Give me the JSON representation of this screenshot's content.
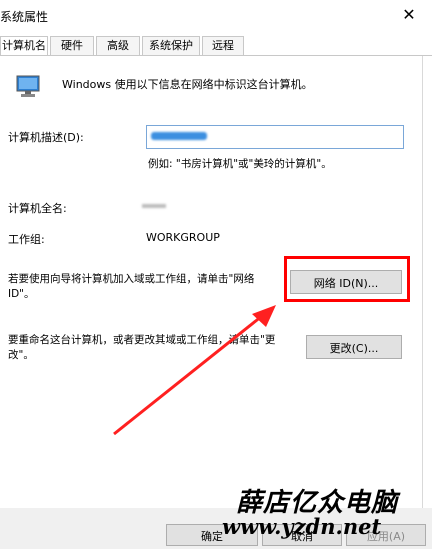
{
  "window": {
    "title": "系统属性",
    "close_glyph": "✕"
  },
  "tabs": [
    {
      "label": "计算机名",
      "active": true
    },
    {
      "label": "硬件",
      "active": false
    },
    {
      "label": "高级",
      "active": false
    },
    {
      "label": "系统保护",
      "active": false
    },
    {
      "label": "远程",
      "active": false
    }
  ],
  "main": {
    "info_text": "Windows 使用以下信息在网络中标识这台计算机。",
    "description_label": "计算机描述(D):",
    "description_example": "例如: \"书房计算机\"或\"美玲的计算机\"。",
    "fullname_label": "计算机全名:",
    "workgroup_label": "工作组:",
    "workgroup_value": "WORKGROUP",
    "network_text": "若要使用向导将计算机加入域或工作组，请单击\"网络 ID\"。",
    "network_button": "网络 ID(N)...",
    "rename_text": "要重命名这台计算机，或者更改其域或工作组，请单击\"更改\"。",
    "change_button": "更改(C)..."
  },
  "footer": {
    "ok_button": "确定",
    "cancel_button": "取消",
    "apply_button": "应用(A)"
  },
  "watermark": {
    "name": "薛店亿众电脑",
    "url": "www.yzdn.net"
  },
  "colors": {
    "highlight": "#ff0000",
    "arrow": "#ff2020"
  },
  "icons": [
    "computer-icon",
    "close-icon",
    "arrow-annotation"
  ]
}
